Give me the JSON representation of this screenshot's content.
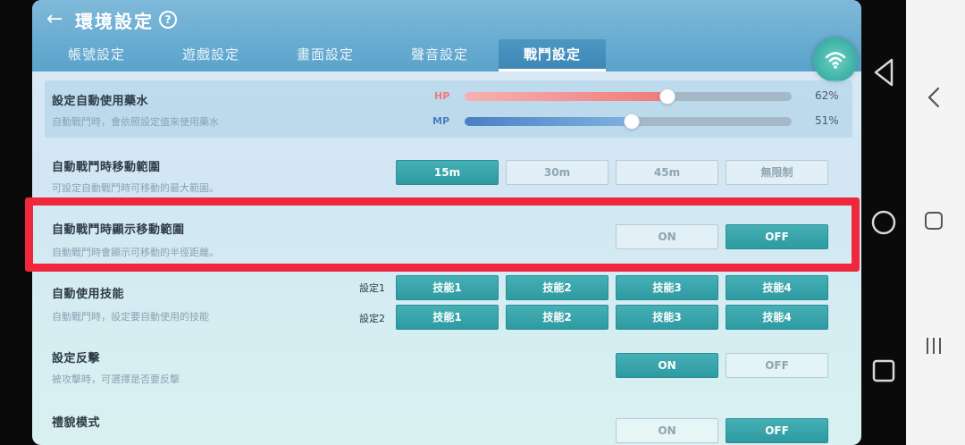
{
  "header": {
    "title": "環境設定",
    "help": "?"
  },
  "tabs": [
    {
      "label": "帳號設定",
      "active": false
    },
    {
      "label": "遊戲設定",
      "active": false
    },
    {
      "label": "畫面設定",
      "active": false
    },
    {
      "label": "聲音設定",
      "active": false
    },
    {
      "label": "戰鬥設定",
      "active": true
    }
  ],
  "potion": {
    "title": "設定自動使用藥水",
    "desc": "自動戰鬥時，會依照設定值來使用藥水",
    "hp": {
      "label": "HP",
      "value": 62,
      "pct": "62%"
    },
    "mp": {
      "label": "MP",
      "value": 51,
      "pct": "51%"
    }
  },
  "range": {
    "title": "自動戰鬥時移動範圍",
    "desc": "可設定自動戰鬥時可移動的最大範圍。",
    "options": [
      "15m",
      "30m",
      "45m",
      "無限制"
    ],
    "selected": 0
  },
  "show_range": {
    "title": "自動戰鬥時顯示移動範圍",
    "desc": "自動戰鬥時會顯示可移動的半徑距離。",
    "on": "ON",
    "off": "OFF",
    "selected": "off"
  },
  "skills": {
    "title": "自動使用技能",
    "desc": "自動戰鬥時，設定要自動使用的技能",
    "set1": "設定1",
    "set2": "設定2",
    "row1": [
      "技能1",
      "技能2",
      "技能3",
      "技能4"
    ],
    "row2": [
      "技能1",
      "技能2",
      "技能3",
      "技能4"
    ]
  },
  "counter": {
    "title": "設定反擊",
    "desc": "被攻擊時，可選擇是否要反擊",
    "on": "ON",
    "off": "OFF",
    "selected": "on"
  },
  "mode": {
    "title": "禮貌模式",
    "on": "ON",
    "off": "OFF",
    "selected": "off"
  },
  "colors": {
    "accent": "#2e9aa1",
    "hp": "#f07a7a",
    "mp": "#4a7fc4",
    "highlight": "#f0283e"
  }
}
